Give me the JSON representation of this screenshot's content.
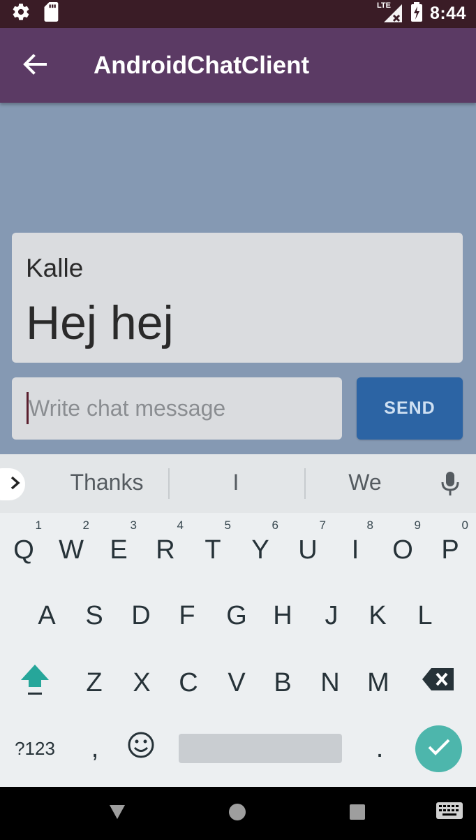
{
  "status_bar": {
    "time": "8:44",
    "network": "LTE",
    "icons": [
      "settings-icon",
      "sd-card-icon",
      "signal-icon",
      "battery-charging-icon"
    ]
  },
  "app_bar": {
    "title": "AndroidChatClient",
    "back_icon": "arrow-back-icon"
  },
  "messages": [
    {
      "author": "Kalle",
      "text": "Hej hej"
    }
  ],
  "compose": {
    "placeholder": "Write chat message",
    "value": "",
    "send_label": "SEND"
  },
  "keyboard": {
    "suggestions": [
      "Thanks",
      "I",
      "We"
    ],
    "row1": [
      {
        "key": "Q",
        "hint": "1"
      },
      {
        "key": "W",
        "hint": "2"
      },
      {
        "key": "E",
        "hint": "3"
      },
      {
        "key": "R",
        "hint": "4"
      },
      {
        "key": "T",
        "hint": "5"
      },
      {
        "key": "Y",
        "hint": "6"
      },
      {
        "key": "U",
        "hint": "7"
      },
      {
        "key": "I",
        "hint": "8"
      },
      {
        "key": "O",
        "hint": "9"
      },
      {
        "key": "P",
        "hint": "0"
      }
    ],
    "row2": [
      "A",
      "S",
      "D",
      "F",
      "G",
      "H",
      "J",
      "K",
      "L"
    ],
    "row3": [
      "Z",
      "X",
      "C",
      "V",
      "B",
      "N",
      "M"
    ],
    "symbols_label": "?123",
    "comma_label": ",",
    "period_label": ".",
    "accent_color": "#4db6ac"
  },
  "nav_bar": {
    "icons": [
      "back-triangle-icon",
      "home-circle-icon",
      "recents-square-icon",
      "keyboard-switch-icon"
    ]
  }
}
